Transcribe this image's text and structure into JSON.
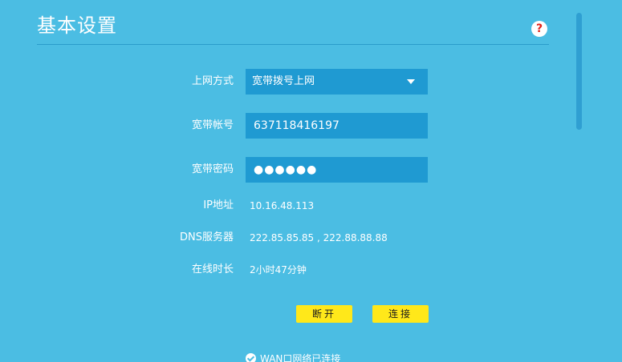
{
  "header": {
    "title": "基本设置",
    "help_glyph": "?"
  },
  "form": {
    "connection_type": {
      "label": "上网方式",
      "value": "宽带拨号上网"
    },
    "account": {
      "label": "宽带帐号",
      "value": "637118416197"
    },
    "password": {
      "label": "宽带密码",
      "masked_value": "●●●●●●"
    },
    "ip_address": {
      "label": "IP地址",
      "value": "10.16.48.113"
    },
    "dns": {
      "label": "DNS服务器",
      "value": "222.85.85.85 , 222.88.88.88"
    },
    "online_duration": {
      "label": "在线时长",
      "value": "2小时47分钟"
    }
  },
  "actions": {
    "disconnect_label": "断开",
    "connect_label": "连接"
  },
  "status": {
    "text": "WAN口网络已连接"
  },
  "colors": {
    "background": "#4bbde3",
    "field": "#1f9ad2",
    "button": "#ffe81a",
    "help_icon": "#e2231a"
  },
  "icons": {
    "help": "question-mark-icon",
    "dropdown": "caret-down-icon",
    "status": "check-circle-icon"
  }
}
